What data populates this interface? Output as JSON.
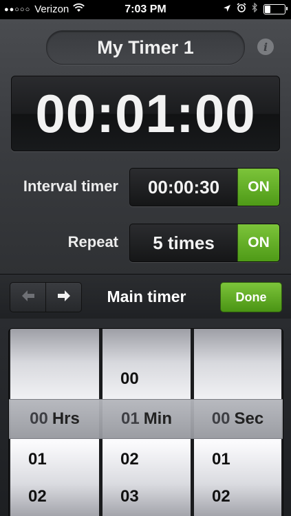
{
  "status_bar": {
    "signal": "●●○○○",
    "carrier": "Verizon",
    "time": "7:03 PM"
  },
  "timer": {
    "name": "My Timer 1",
    "display": "00:01:00"
  },
  "interval": {
    "label": "Interval timer",
    "value": "00:00:30",
    "toggle": "ON"
  },
  "repeat": {
    "label": "Repeat",
    "value": "5 times",
    "toggle": "ON"
  },
  "toolbar": {
    "title": "Main timer",
    "done_label": "Done"
  },
  "picker": {
    "hours": {
      "above": [],
      "selected": "00",
      "unit": "Hrs",
      "below": [
        "01",
        "02"
      ]
    },
    "minutes": {
      "above": [
        "00"
      ],
      "selected": "01",
      "unit": "Min",
      "below": [
        "02",
        "03"
      ]
    },
    "seconds": {
      "above": [],
      "selected": "00",
      "unit": "Sec",
      "below": [
        "01",
        "02"
      ]
    }
  },
  "colors": {
    "accent_green": "#5fae22",
    "panel_dark": "#3c3e42"
  }
}
